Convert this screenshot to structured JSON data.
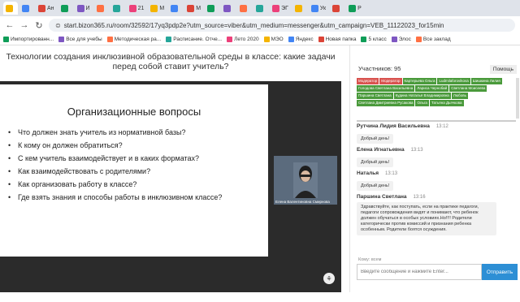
{
  "browser": {
    "tabs": [
      "",
      "",
      "Ан",
      "",
      "И",
      "",
      "",
      "21",
      "М",
      "",
      "M",
      "",
      "",
      "",
      "",
      "ЭГ",
      "",
      "Ук",
      "",
      "Р"
    ],
    "url": "start.bizon365.ru/room/32592/17yq3pdp2e?utm_source=viber&utm_medium=messenger&utm_campaign=VEB_11122023_for15min",
    "bookmarks": [
      "Импортированн...",
      "Все для учебы",
      "Методическая ра...",
      "Расписание. Отче...",
      "Лето 2020",
      "МЭО",
      "Яндекс",
      "Новая папка",
      "5 класс",
      "Элос",
      "Все заклад"
    ]
  },
  "page": {
    "title": "Технологии создания инклюзивной образовательной среды в классе: какие задачи перед собой ставит учитель?",
    "slide_heading": "Организационные вопросы",
    "slide_points": [
      "Что должен знать учитель из нормативной базы?",
      "К кому он должен обратиться?",
      "С кем учитель взаимодействует и в каких форматах?",
      "Как взаимодействовать с родителями?",
      "Как организовать работу в классе?",
      "Где взять знания и способы работы в инклюзивном классе?"
    ],
    "camera_label": "Елена Валентиновна Смирнова"
  },
  "sidebar": {
    "participants": "Участников: 95",
    "help": "Помощь",
    "chips": [
      {
        "text": "Модератор",
        "color": "red"
      },
      {
        "text": "Модератор",
        "color": "red"
      },
      {
        "text": "Картерьева Ольга",
        "color": "green"
      },
      {
        "text": "Ludmilaforovikova",
        "color": "green"
      },
      {
        "text": "Шишкина Лилия",
        "color": "green"
      },
      {
        "text": "Голодова Светлана Васильевна",
        "color": "green"
      },
      {
        "text": "Лариса Чернобай",
        "color": "green"
      },
      {
        "text": "Светлана Моисеева",
        "color": "green"
      },
      {
        "text": "Паршина Светлана",
        "color": "green"
      },
      {
        "text": "Кудина Наталья Владимировна",
        "color": "green"
      },
      {
        "text": "Любовь",
        "color": "green"
      },
      {
        "text": "Светлана Дмитриевна Русакова",
        "color": "green"
      },
      {
        "text": "Ольга",
        "color": "green"
      },
      {
        "text": "Татьяна Дьячкова",
        "color": "green"
      }
    ],
    "messages": [
      {
        "who": "Рутчина Лидия Васильевна",
        "time": "13:12",
        "text": "Добрый день!"
      },
      {
        "who": "Елена Игнатьевна",
        "time": "13:13",
        "text": "Добрый день!"
      },
      {
        "who": "Наталья",
        "time": "13:13",
        "text": "Добрый день!"
      },
      {
        "who": "Паршина Светлана",
        "time": "13:16",
        "text": "Здравствуйте, как поступать, если на практике педагоги, педагоги сопровождения видят и понимают, что ребенок должен обучаться в особых условиях.Но!!!! Родители категорически против комиссий и признания ребенка особенным. Родители боятся осуждения."
      }
    ],
    "to_label": "Кому: всем",
    "input_placeholder": "Введите сообщение и нажмите Enter...",
    "send": "Отправить"
  },
  "colors": {
    "moderator": "#d9534f",
    "participant": "#4a9a3b",
    "send": "#2d8fd5"
  }
}
